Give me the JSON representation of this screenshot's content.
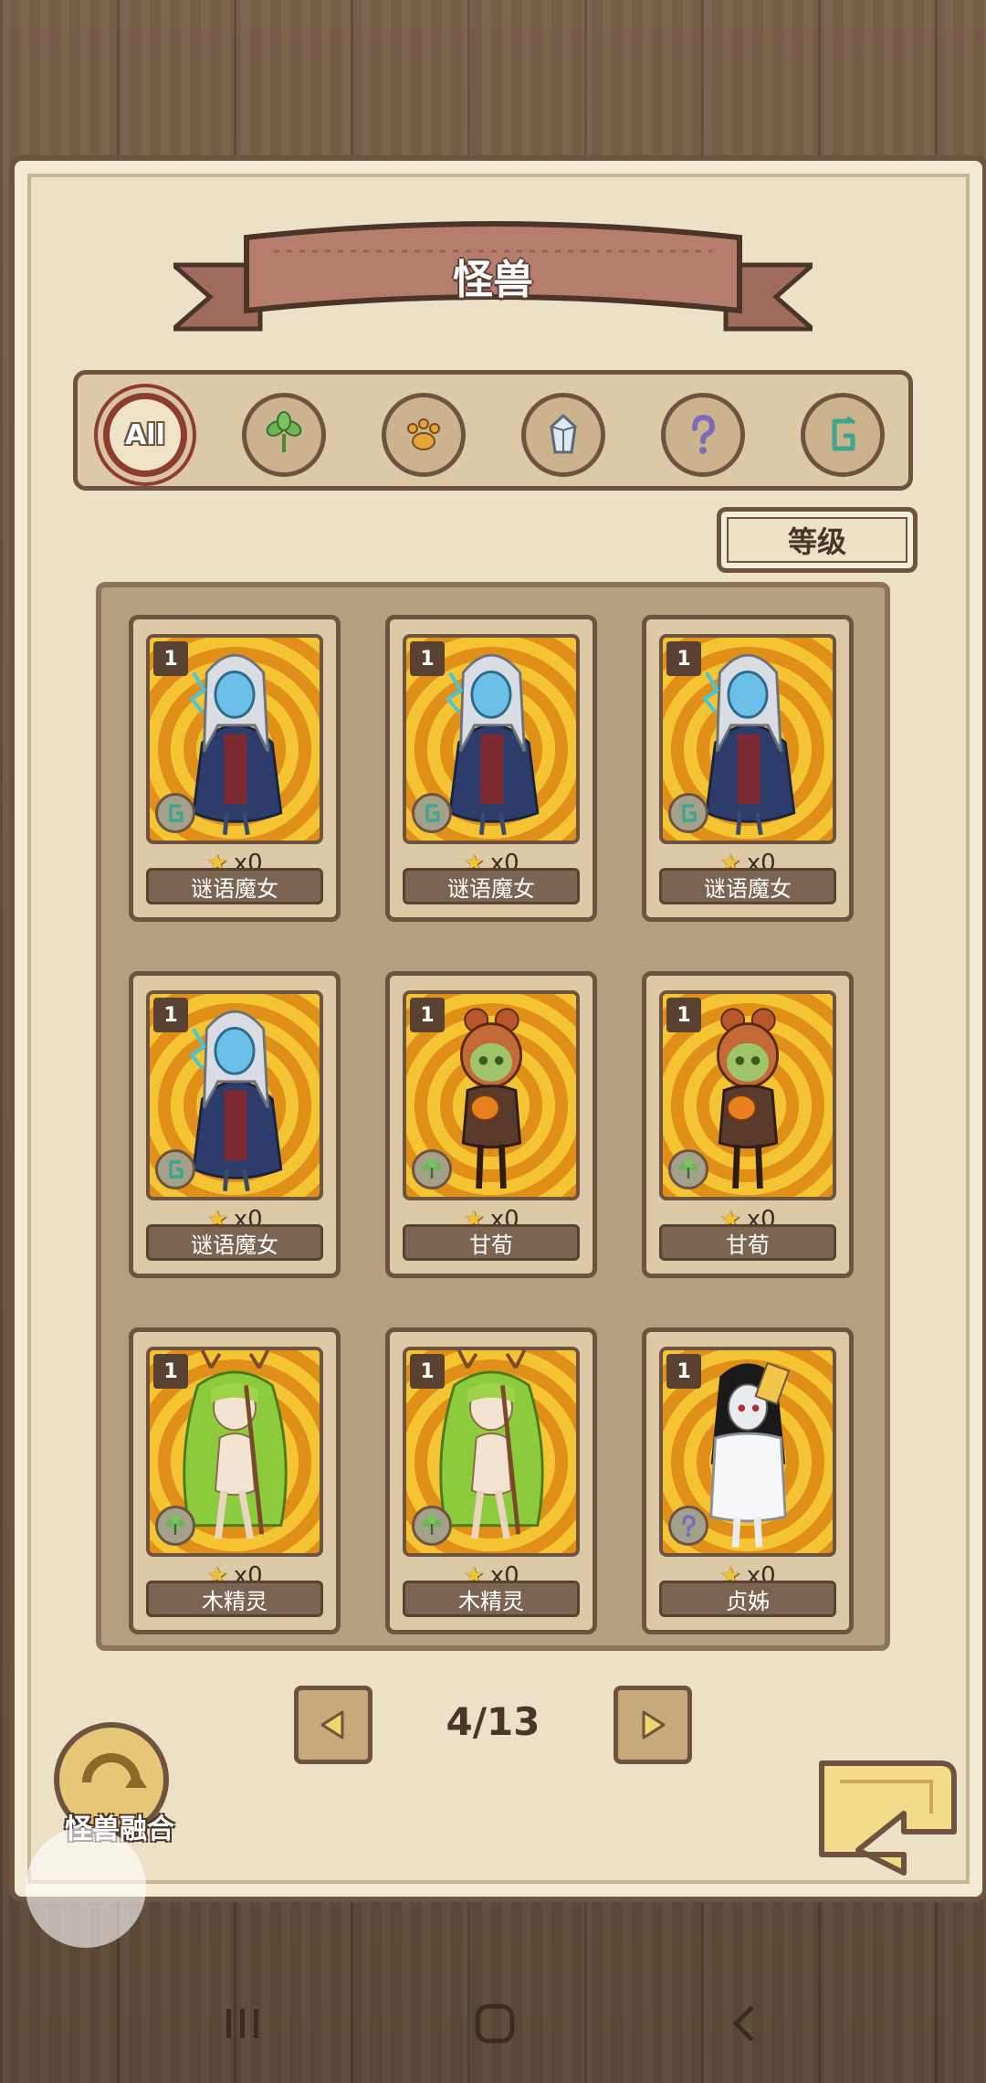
{
  "header": {
    "title": "怪兽"
  },
  "filters": [
    {
      "id": "all",
      "label": "All",
      "icon": "all-icon",
      "active": true
    },
    {
      "id": "plant",
      "icon": "leaf-icon",
      "active": false
    },
    {
      "id": "beast",
      "icon": "paw-icon",
      "active": false
    },
    {
      "id": "mineral",
      "icon": "crystal-icon",
      "active": false
    },
    {
      "id": "unknown",
      "icon": "question-icon",
      "active": false
    },
    {
      "id": "magic",
      "icon": "rune-icon",
      "active": false
    }
  ],
  "sort": {
    "label": "等级"
  },
  "cards": [
    {
      "level": "1",
      "count": "x0",
      "name": "谜语魔女",
      "element": "rune-icon",
      "character": "witch"
    },
    {
      "level": "1",
      "count": "x0",
      "name": "谜语魔女",
      "element": "rune-icon",
      "character": "witch"
    },
    {
      "level": "1",
      "count": "x0",
      "name": "谜语魔女",
      "element": "rune-icon",
      "character": "witch"
    },
    {
      "level": "1",
      "count": "x0",
      "name": "谜语魔女",
      "element": "rune-icon",
      "character": "witch"
    },
    {
      "level": "1",
      "count": "x0",
      "name": "甘荀",
      "element": "leaf-icon",
      "character": "carrot-girl"
    },
    {
      "level": "1",
      "count": "x0",
      "name": "甘荀",
      "element": "leaf-icon",
      "character": "carrot-girl"
    },
    {
      "level": "1",
      "count": "x0",
      "name": "木精灵",
      "element": "leaf-icon",
      "character": "dryad"
    },
    {
      "level": "1",
      "count": "x0",
      "name": "木精灵",
      "element": "leaf-icon",
      "character": "dryad"
    },
    {
      "level": "1",
      "count": "x0",
      "name": "贞姊",
      "element": "question-icon",
      "character": "ghost-girl"
    }
  ],
  "pagination": {
    "label": "4/13"
  },
  "fusion": {
    "label": "怪兽融合"
  },
  "colors": {
    "accent": "#8c3d2d",
    "parchment": "#ece1c6",
    "border": "#6e5440",
    "card_bg": "#f5c433"
  }
}
